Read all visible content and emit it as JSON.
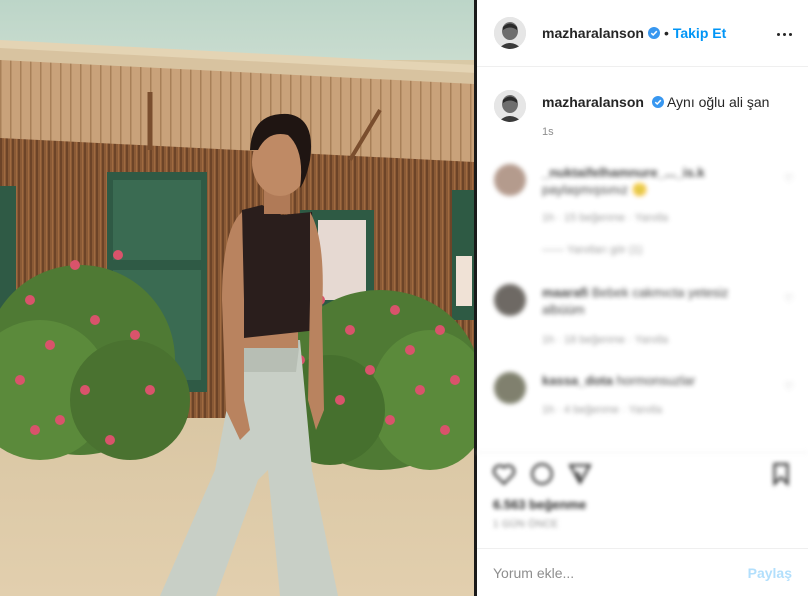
{
  "post": {
    "author": "mazharalanson",
    "follow_label": "Takip Et",
    "separator": "•",
    "caption": "Aynı oğlu ali şan",
    "caption_time": "1s"
  },
  "comments": [
    {
      "user": "_nuktaifelhamnure_..._is.k",
      "text": "paylaşmışsınız 🙂",
      "meta": "1h  ·  15 beğenme  ·  Yanıtla",
      "replies": "—— Yanıtları gör (1)"
    },
    {
      "user": "maarafi",
      "text": "Bebek cakmıcta yetesiz albüüm",
      "meta": "1h  ·  18 beğenme  ·  Yanıtla"
    },
    {
      "user": "kassa_dota",
      "text": "hormonsuzlar",
      "meta": "1h  ·  4 beğenme  ·  Yanıtla"
    }
  ],
  "actions": {
    "likes": "6.563 beğenme",
    "date": "1 GÜN ÖNCE"
  },
  "comment_box": {
    "placeholder": "Yorum ekle...",
    "share_label": "Paylaş"
  },
  "colors": {
    "accent": "#0095f6",
    "share_disabled": "#b2dffc",
    "verified": "#3897f0"
  },
  "icons": [
    "verified-badge-icon",
    "more-options-icon",
    "heart-icon",
    "comment-icon",
    "share-icon",
    "bookmark-icon"
  ]
}
